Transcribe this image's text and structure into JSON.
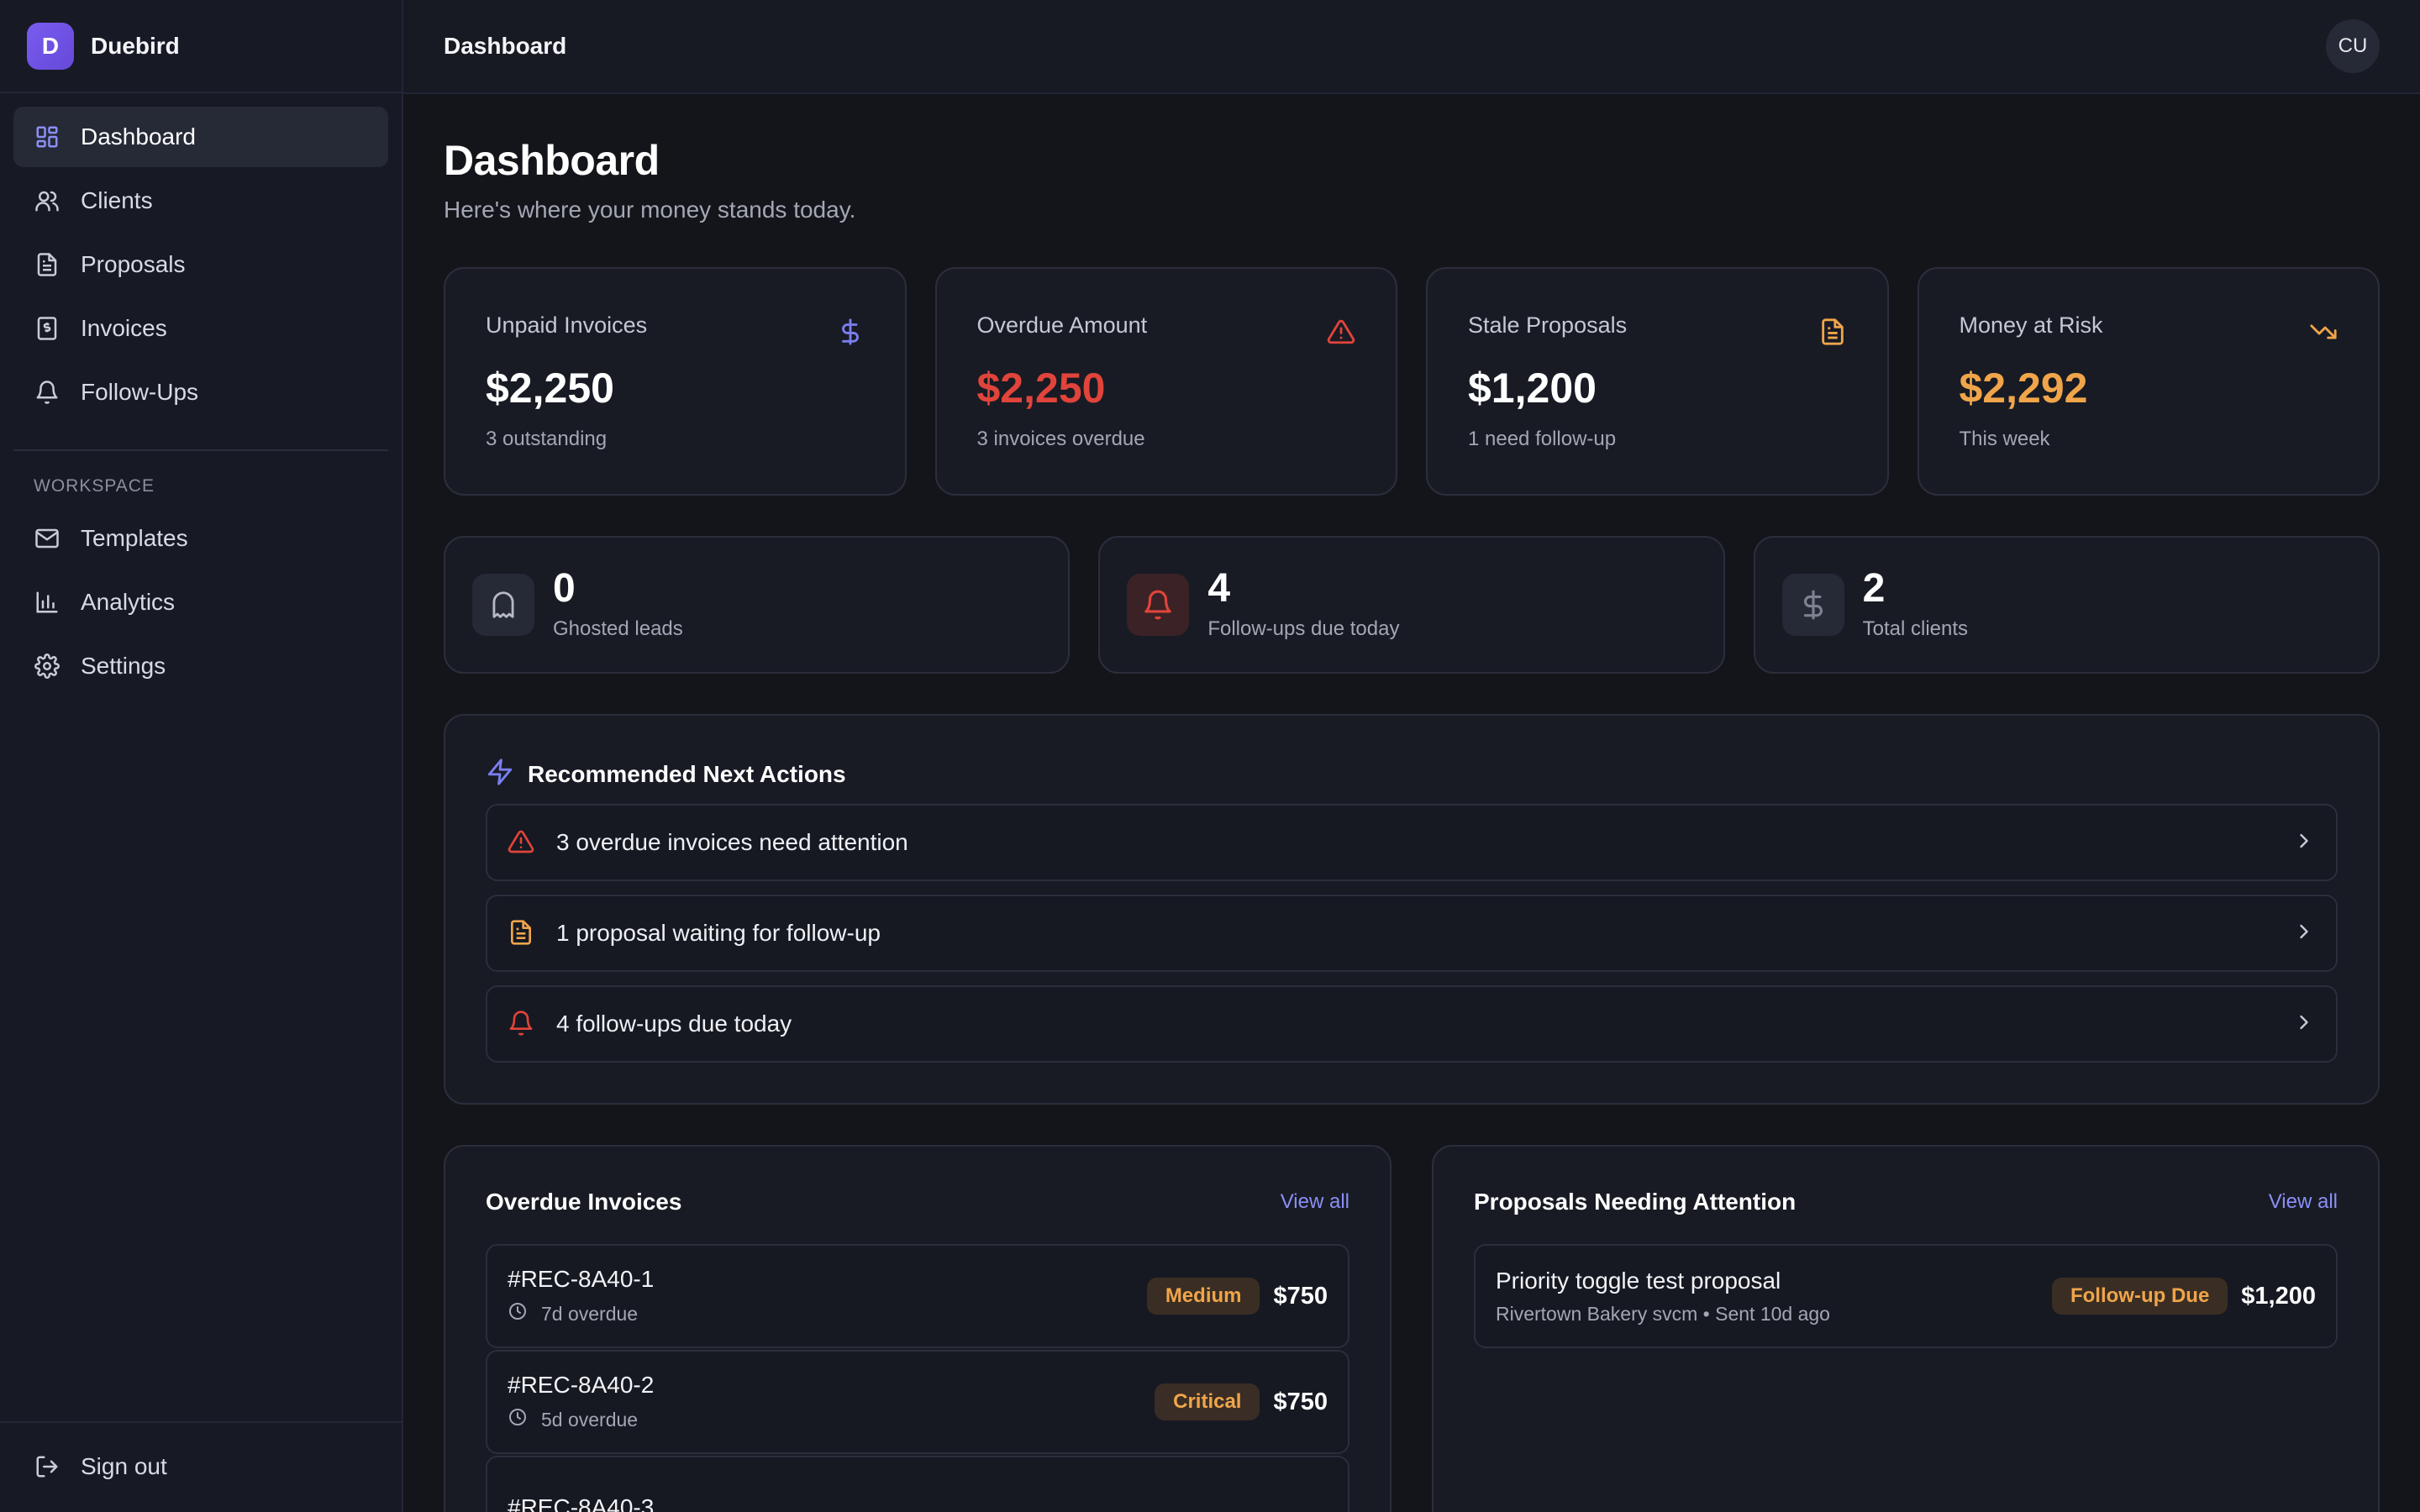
{
  "brand": {
    "logo_letter": "D",
    "name": "Duebird"
  },
  "sidebar": {
    "items": [
      {
        "label": "Dashboard",
        "icon": "dashboard-icon",
        "active": true
      },
      {
        "label": "Clients",
        "icon": "users-icon"
      },
      {
        "label": "Proposals",
        "icon": "file-text-icon"
      },
      {
        "label": "Invoices",
        "icon": "receipt-icon"
      },
      {
        "label": "Follow-Ups",
        "icon": "bell-icon"
      }
    ],
    "section_label": "WORKSPACE",
    "workspace_items": [
      {
        "label": "Templates",
        "icon": "mail-icon"
      },
      {
        "label": "Analytics",
        "icon": "bar-chart-icon"
      },
      {
        "label": "Settings",
        "icon": "gear-icon"
      }
    ],
    "sign_out": "Sign out"
  },
  "topbar": {
    "title": "Dashboard",
    "avatar_initials": "CU"
  },
  "page": {
    "title": "Dashboard",
    "subtitle": "Here's where your money stands today."
  },
  "stats": [
    {
      "label": "Unpaid Invoices",
      "value": "$2,250",
      "sub": "3 outstanding",
      "icon": "dollar-icon",
      "color": "#ffffff",
      "icon_color": "#7a7ff0"
    },
    {
      "label": "Overdue Amount",
      "value": "$2,250",
      "sub": "3 invoices overdue",
      "icon": "alert-triangle-icon",
      "color": "#e0443a",
      "icon_color": "#e0443a"
    },
    {
      "label": "Stale Proposals",
      "value": "$1,200",
      "sub": "1 need follow-up",
      "icon": "file-text-icon",
      "color": "#ffffff",
      "icon_color": "#f0a54a"
    },
    {
      "label": "Money at Risk",
      "value": "$2,292",
      "sub": "This week",
      "icon": "trending-down-icon",
      "color": "#f0a54a",
      "icon_color": "#f0a54a"
    }
  ],
  "mini_stats": [
    {
      "value": "0",
      "label": "Ghosted leads",
      "icon": "ghost-icon"
    },
    {
      "value": "4",
      "label": "Follow-ups due today",
      "icon": "bell-icon"
    },
    {
      "value": "2",
      "label": "Total clients",
      "icon": "dollar-icon"
    }
  ],
  "actions": {
    "title": "Recommended Next Actions",
    "items": [
      {
        "text": "3 overdue invoices need attention",
        "icon": "alert-triangle-icon"
      },
      {
        "text": "1 proposal waiting for follow-up",
        "icon": "file-text-icon"
      },
      {
        "text": "4 follow-ups due today",
        "icon": "bell-icon"
      }
    ]
  },
  "overdue_invoices": {
    "title": "Overdue Invoices",
    "view_all": "View all",
    "items": [
      {
        "id": "#REC-8A40-1",
        "meta": "7d overdue",
        "badge": "Medium",
        "amount": "$750"
      },
      {
        "id": "#REC-8A40-2",
        "meta": "5d overdue",
        "badge": "Critical",
        "amount": "$750"
      },
      {
        "id": "#REC-8A40-3",
        "meta": "",
        "badge": "",
        "amount": ""
      }
    ]
  },
  "proposals": {
    "title": "Proposals Needing Attention",
    "view_all": "View all",
    "items": [
      {
        "title": "Priority toggle test proposal",
        "meta": "Rivertown Bakery svcm • Sent 10d ago",
        "badge": "Follow-up Due",
        "amount": "$1,200"
      }
    ]
  },
  "colors": {
    "accent": "#7a5cf0",
    "danger": "#e0443a",
    "warning": "#f0a54a",
    "link": "#8a8ff5"
  }
}
